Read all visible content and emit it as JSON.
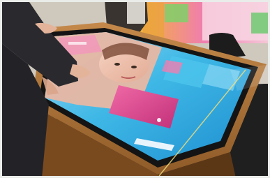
{
  "scene": {
    "subject": "photo",
    "screen_cta_text": "",
    "screen_brand_text": ""
  },
  "colors": {
    "table_wood": "#b07a3c",
    "screen_cyan": "#3fb8e6",
    "screen_magenta": "#e2468f",
    "floor": "#2b2b2b"
  }
}
